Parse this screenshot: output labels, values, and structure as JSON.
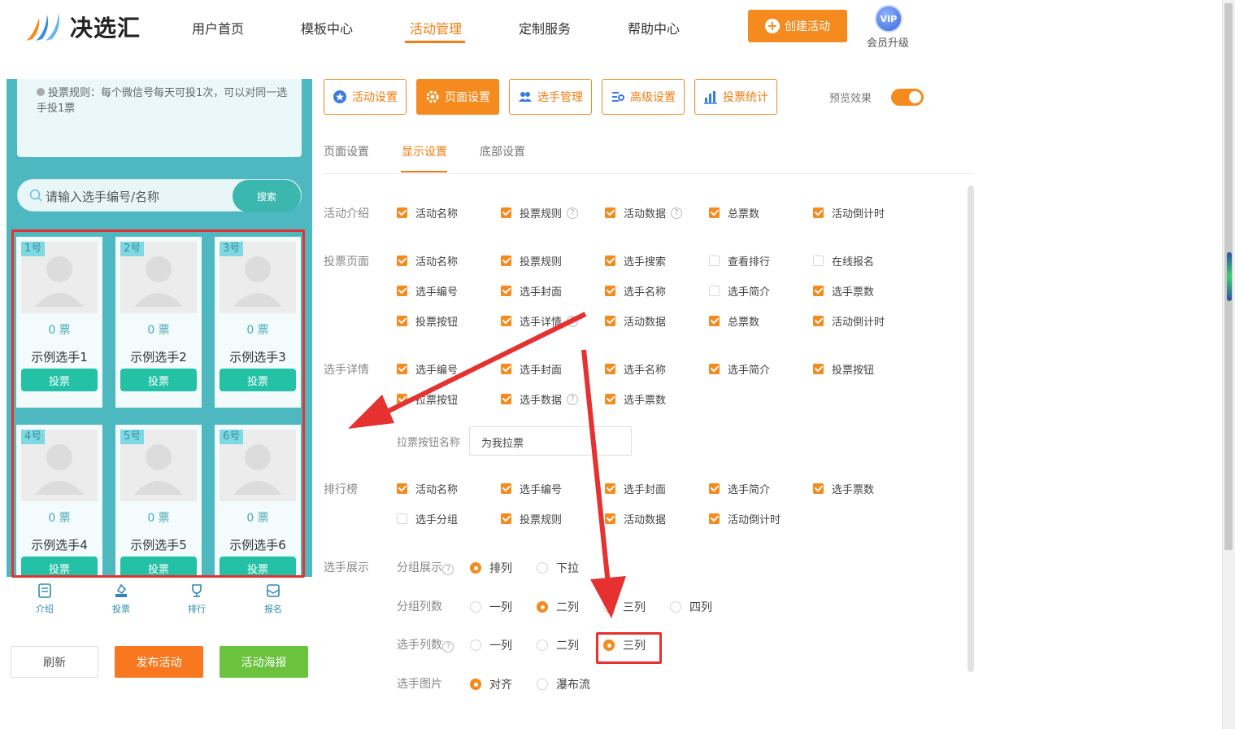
{
  "header": {
    "brand": "决选汇",
    "nav": [
      "用户首页",
      "模板中心",
      "活动管理",
      "定制服务",
      "帮助中心"
    ],
    "active_nav": "活动管理",
    "create_button": "创建活动",
    "vip_badge": "VIP",
    "vip_label": "会员升级"
  },
  "preview": {
    "rule_text": "投票规则：每个微信号每天可投1次，可以对同一选手投1票",
    "search_placeholder": "请输入选手编号/名称",
    "search_button": "搜索",
    "contestants": [
      {
        "num": "1号",
        "votes": "0 票",
        "name": "示例选手1",
        "button": "投票"
      },
      {
        "num": "2号",
        "votes": "0 票",
        "name": "示例选手2",
        "button": "投票"
      },
      {
        "num": "3号",
        "votes": "0 票",
        "name": "示例选手3",
        "button": "投票"
      },
      {
        "num": "4号",
        "votes": "0 票",
        "name": "示例选手4",
        "button": "投票"
      },
      {
        "num": "5号",
        "votes": "0 票",
        "name": "示例选手5",
        "button": "投票"
      },
      {
        "num": "6号",
        "votes": "0 票",
        "name": "示例选手6",
        "button": "投票"
      }
    ],
    "tabbar": [
      "介绍",
      "投票",
      "排行",
      "报名"
    ],
    "buttons": {
      "refresh": "刷新",
      "publish": "发布活动",
      "poster": "活动海报"
    }
  },
  "settings": {
    "tabs": [
      "活动设置",
      "页面设置",
      "选手管理",
      "高级设置",
      "投票统计"
    ],
    "active_tab": "页面设置",
    "preview_label": "预览效果",
    "preview_on": true,
    "sub_tabs": [
      "页面设置",
      "显示设置",
      "底部设置"
    ],
    "active_sub_tab": "显示设置",
    "sections": {
      "intro": {
        "label": "活动介绍",
        "items": [
          {
            "label": "活动名称",
            "checked": true
          },
          {
            "label": "投票规则",
            "checked": true,
            "help": true
          },
          {
            "label": "活动数据",
            "checked": true,
            "help": true
          },
          {
            "label": "总票数",
            "checked": true
          },
          {
            "label": "活动倒计时",
            "checked": true
          }
        ]
      },
      "vote_page": {
        "label": "投票页面",
        "items": [
          {
            "label": "活动名称",
            "checked": true
          },
          {
            "label": "投票规则",
            "checked": true
          },
          {
            "label": "选手搜索",
            "checked": true
          },
          {
            "label": "查看排行",
            "checked": false
          },
          {
            "label": "在线报名",
            "checked": false
          },
          {
            "label": "选手编号",
            "checked": true
          },
          {
            "label": "选手封面",
            "checked": true
          },
          {
            "label": "选手名称",
            "checked": true
          },
          {
            "label": "选手简介",
            "checked": false
          },
          {
            "label": "选手票数",
            "checked": true
          },
          {
            "label": "投票按钮",
            "checked": true
          },
          {
            "label": "选手详情",
            "checked": true,
            "help": true
          },
          {
            "label": "活动数据",
            "checked": true
          },
          {
            "label": "总票数",
            "checked": true
          },
          {
            "label": "活动倒计时",
            "checked": true
          }
        ]
      },
      "detail": {
        "label": "选手详情",
        "items": [
          {
            "label": "选手编号",
            "checked": true
          },
          {
            "label": "选手封面",
            "checked": true
          },
          {
            "label": "选手名称",
            "checked": true
          },
          {
            "label": "选手简介",
            "checked": true
          },
          {
            "label": "投票按钮",
            "checked": true
          },
          {
            "label": "拉票按钮",
            "checked": true
          },
          {
            "label": "选手数据",
            "checked": true,
            "help": true
          },
          {
            "label": "选手票数",
            "checked": true
          }
        ],
        "canvass_label": "拉票按钮名称",
        "canvass_value": "为我拉票"
      },
      "rank": {
        "label": "排行榜",
        "items": [
          {
            "label": "活动名称",
            "checked": true
          },
          {
            "label": "选手编号",
            "checked": true
          },
          {
            "label": "选手封面",
            "checked": true
          },
          {
            "label": "选手简介",
            "checked": true
          },
          {
            "label": "选手票数",
            "checked": true
          },
          {
            "label": "选手分组",
            "checked": false
          },
          {
            "label": "投票规则",
            "checked": true
          },
          {
            "label": "活动数据",
            "checked": true
          },
          {
            "label": "活动倒计时",
            "checked": true
          }
        ]
      },
      "display": {
        "label": "选手展示",
        "group_display": {
          "label": "分组展示",
          "options": [
            "排列",
            "下拉"
          ],
          "selected": "排列"
        },
        "group_columns": {
          "label": "分组列数",
          "options": [
            "一列",
            "二列",
            "三列",
            "四列"
          ],
          "selected": "二列"
        },
        "player_columns": {
          "label": "选手列数",
          "options": [
            "一列",
            "二列",
            "三列"
          ],
          "selected": "三列"
        },
        "player_image": {
          "label": "选手图片",
          "options": [
            "对齐",
            "瀑布流"
          ],
          "selected": "对齐"
        }
      }
    }
  },
  "colors": {
    "accent": "#f58a1f",
    "preview_bg": "#4db8c0",
    "vote_button": "#23c1a5",
    "annotation": "#e5312f"
  }
}
